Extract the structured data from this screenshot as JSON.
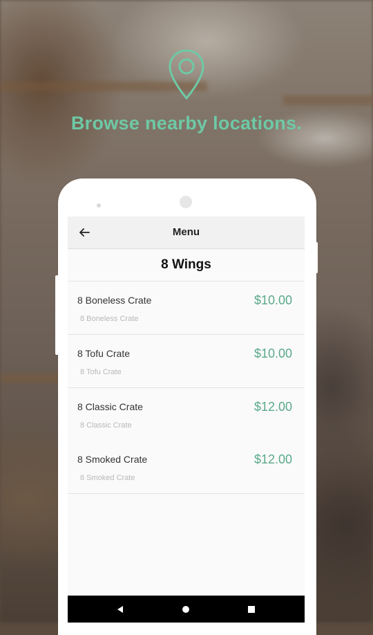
{
  "tagline": "Browse nearby locations.",
  "icons": {
    "location": "location-pin-icon",
    "back": "arrow-left-icon",
    "nav_back": "triangle-back-icon",
    "nav_home": "circle-home-icon",
    "nav_recents": "square-recents-icon"
  },
  "colors": {
    "accent": "#6ec9a5",
    "price": "#5aa98a",
    "navbar": "#000000"
  },
  "appbar": {
    "title": "Menu"
  },
  "section": {
    "title": "8 Wings"
  },
  "items": [
    {
      "name": "8 Boneless Crate",
      "description": "8 Boneless Crate",
      "price": "$10.00"
    },
    {
      "name": "8 Tofu Crate",
      "description": "8 Tofu Crate",
      "price": "$10.00"
    },
    {
      "name": "8 Classic Crate",
      "description": "8 Classic Crate",
      "price": "$12.00"
    },
    {
      "name": "8 Smoked Crate",
      "description": "8 Smoked Crate",
      "price": "$12.00"
    }
  ]
}
